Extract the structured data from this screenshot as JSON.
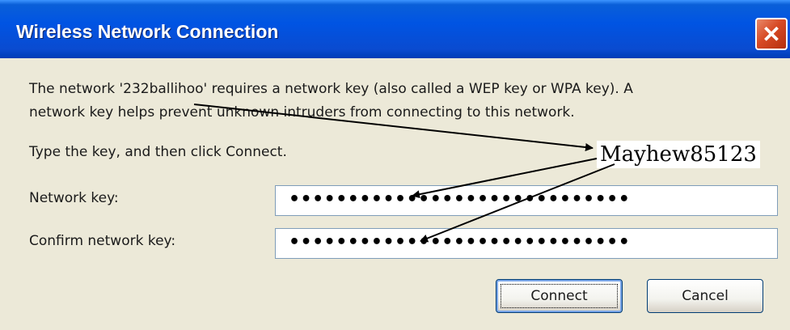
{
  "window": {
    "title": "Wireless Network Connection",
    "close_glyph": "✕"
  },
  "message": {
    "line1": "The network '232ballihoo' requires a network key (also called a WEP key or WPA key). A",
    "line2": "network key helps prevent unknown intruders from connecting to this network.",
    "instruction": "Type the key, and then click Connect."
  },
  "fields": {
    "network_key": {
      "label": "Network key:",
      "value": "•••••••••••••••••••••••••••••"
    },
    "confirm_key": {
      "label": "Confirm network key:",
      "value": "•••••••••••••••••••••••••••••"
    }
  },
  "buttons": {
    "connect": "Connect",
    "cancel": "Cancel"
  },
  "annotation": {
    "key_text": "Mayhew85123"
  },
  "colors": {
    "titlebar": "#0054e3",
    "dialog_bg": "#ece9d8",
    "close_button": "#d74a25"
  },
  "icons": {
    "close": "close-icon"
  }
}
